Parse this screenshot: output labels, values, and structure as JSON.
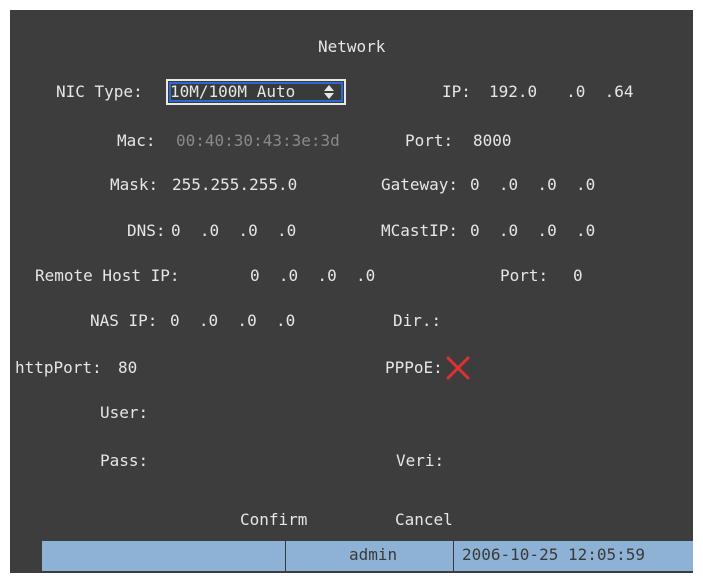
{
  "window": {
    "title": "Network"
  },
  "fields": {
    "nic_type": {
      "label": "NIC Type:",
      "value": "10M/100M Auto"
    },
    "ip": {
      "label": "IP:",
      "value": "192.0   .0  .64"
    },
    "mac": {
      "label": "Mac:",
      "value": "00:40:30:43:3e:3d"
    },
    "port": {
      "label": "Port:",
      "value": "8000"
    },
    "mask": {
      "label": "Mask:",
      "value": "255.255.255.0"
    },
    "gateway": {
      "label": "Gateway:",
      "value": "0  .0  .0  .0"
    },
    "dns": {
      "label": "DNS:",
      "value": "0  .0  .0  .0"
    },
    "mcast_ip": {
      "label": "MCastIP:",
      "value": "0  .0  .0  .0"
    },
    "remote_host_ip": {
      "label": "Remote Host IP:",
      "value": "0  .0  .0  .0"
    },
    "remote_port": {
      "label": "Port:",
      "value": "0"
    },
    "nas_ip": {
      "label": "NAS IP:",
      "value": "0  .0  .0  .0"
    },
    "dir": {
      "label": "Dir.:",
      "value": ""
    },
    "http_port": {
      "label": "httpPort:",
      "value": "80"
    },
    "pppoe": {
      "label": "PPPoE:",
      "checked": false,
      "icon": "x-mark-icon",
      "color": "#e03030"
    },
    "user": {
      "label": "User:",
      "value": ""
    },
    "pass": {
      "label": "Pass:",
      "value": ""
    },
    "veri": {
      "label": "Veri:",
      "value": ""
    }
  },
  "buttons": {
    "confirm": "Confirm",
    "cancel": "Cancel"
  },
  "status": {
    "user": "admin",
    "datetime": "2006-10-25 12:05:59"
  },
  "colors": {
    "background": "#3d3d3d",
    "text": "#e6e6e6",
    "statusbar": "#8eb2d6",
    "focus_border": "#2a6bd0"
  }
}
